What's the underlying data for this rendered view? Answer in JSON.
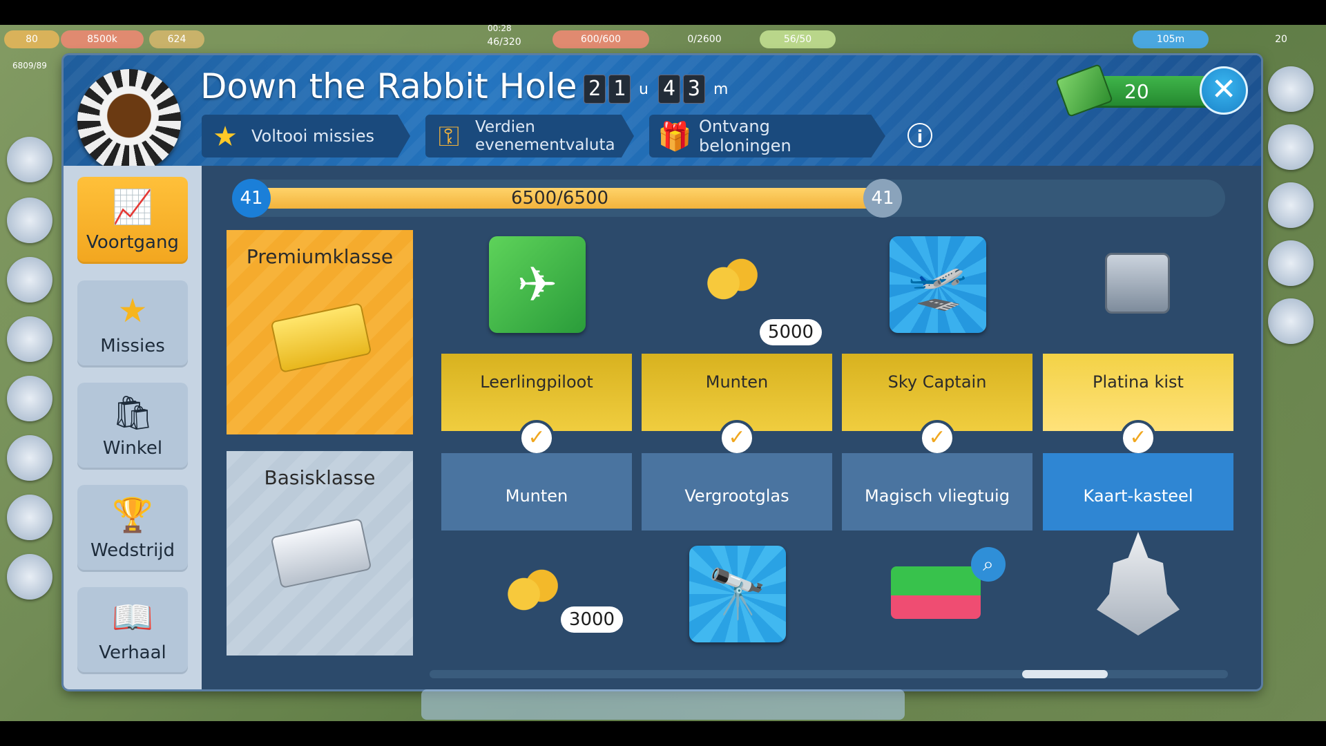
{
  "hud": {
    "level": "80",
    "xp": "8500k",
    "stars": "624",
    "population": "6809/89",
    "time": "00:28",
    "fuel": "46/320",
    "cargo": "600/600",
    "storage": "0/2600",
    "crew": "56/50",
    "coins": "105m",
    "cash": "20"
  },
  "header": {
    "title": "Down the Rabbit Hole",
    "timer": {
      "h1": "2",
      "h2": "1",
      "hunit": "u",
      "m1": "4",
      "m2": "3",
      "munit": "m"
    },
    "tabs": [
      {
        "label": "Voltooi missies",
        "icon": "star-icon"
      },
      {
        "label": "Verdien evenementvaluta",
        "icon": "key-icon"
      },
      {
        "label": "Ontvang beloningen",
        "icon": "gift-icon"
      }
    ],
    "info": "i",
    "currency": "20",
    "close": "✕"
  },
  "sidebar": [
    {
      "label": "Voortgang",
      "icon": "progress-chart-icon",
      "glyph": "📈",
      "active": true
    },
    {
      "label": "Missies",
      "icon": "star-icon",
      "glyph": "★",
      "active": false
    },
    {
      "label": "Winkel",
      "icon": "shopping-bag-icon",
      "glyph": "🛍",
      "active": false
    },
    {
      "label": "Wedstrijd",
      "icon": "trophy-icon",
      "glyph": "🏆",
      "active": false
    },
    {
      "label": "Verhaal",
      "icon": "book-icon",
      "glyph": "📖",
      "active": false
    }
  ],
  "progress": {
    "level_left": "41",
    "level_right": "41",
    "text": "6500/6500",
    "value": 6500,
    "max": 6500
  },
  "classes": {
    "premium": "Premiumklasse",
    "basic": "Basisklasse"
  },
  "rewards": [
    {
      "premium_label": "Leerlingpiloot",
      "premium_icon": "plane-star-icon",
      "premium_amount": "",
      "basic_label": "Munten",
      "basic_icon": "coins-icon",
      "basic_amount": "3000"
    },
    {
      "premium_label": "Munten",
      "premium_icon": "coins-icon",
      "premium_amount": "5000",
      "basic_label": "Vergrootglas",
      "basic_icon": "spyglass-icon",
      "basic_amount": ""
    },
    {
      "premium_label": "Sky Captain",
      "premium_icon": "plane-calendar-icon",
      "premium_amount": "",
      "basic_label": "Magisch vliegtuig",
      "basic_icon": "flamingo-plane-icon",
      "basic_amount": ""
    },
    {
      "premium_label": "Platina kist",
      "premium_icon": "platinum-chest-icon",
      "premium_amount": "",
      "basic_label": "Kaart-kasteel",
      "basic_icon": "card-castle-icon",
      "basic_amount": ""
    }
  ],
  "colors": {
    "panel": "#2c4a6b",
    "premium": "#f2b33c",
    "accent": "#1b83c8",
    "basic_highlight": "#2f86d3"
  }
}
